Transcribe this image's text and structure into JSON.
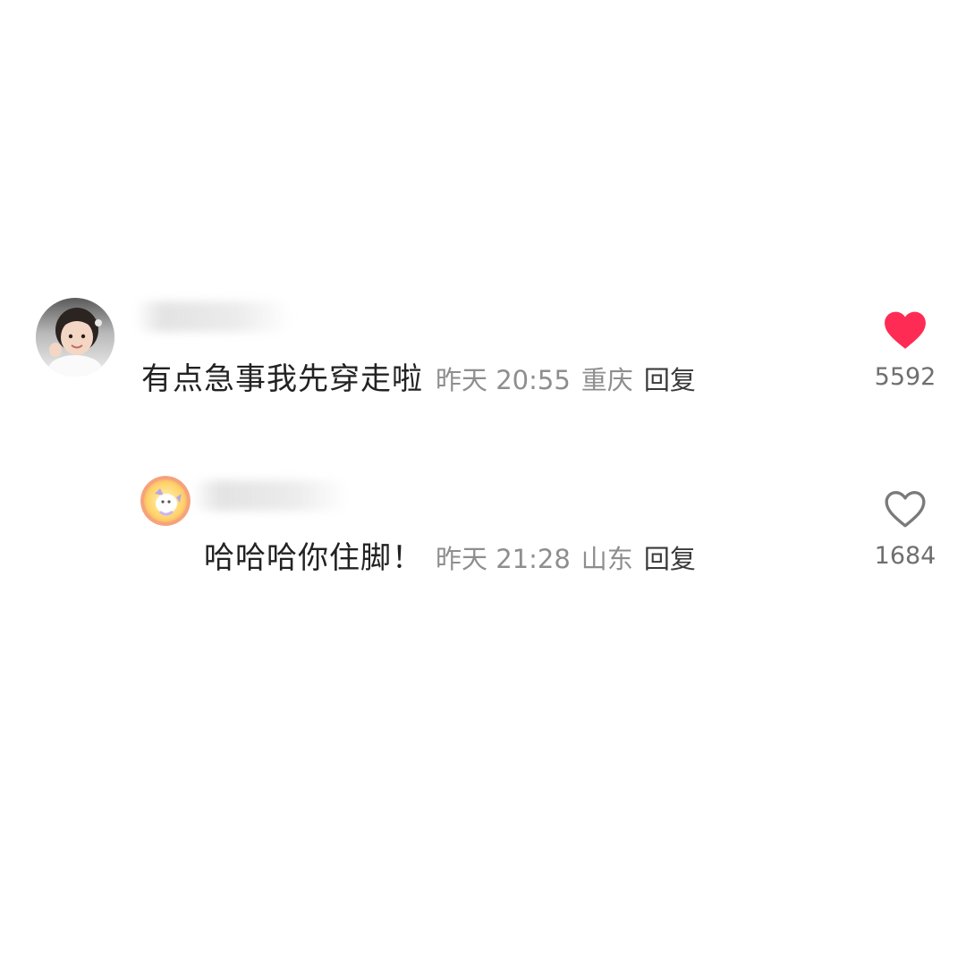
{
  "comments": [
    {
      "text": "有点急事我先穿走啦",
      "time": "昨天 20:55",
      "location": "重庆",
      "reply_label": "回复",
      "likes": "5592",
      "liked": true,
      "like_color": "#fe2c55"
    },
    {
      "text": "哈哈哈你住脚！",
      "time": "昨天 21:28",
      "location": "山东",
      "reply_label": "回复",
      "likes": "1684",
      "liked": false,
      "like_color": "#7a7a7a"
    }
  ]
}
